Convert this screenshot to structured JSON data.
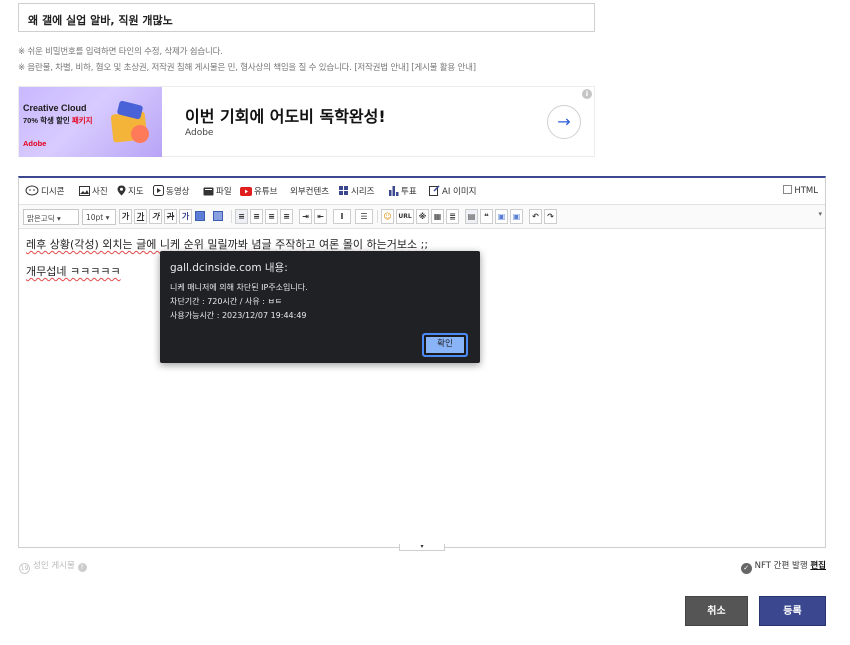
{
  "title_field": {
    "value": "왜 갤에 실업 알바, 직원 개많노"
  },
  "notices": [
    "※ 쉬운 비밀번호를 입력하면 타인의 수정, 삭제가 쉽습니다.",
    "※ 음란물, 차별, 비하, 혐오 및 초상권, 저작권 침해 게시물은 민, 형사상의 책임을 질 수 있습니다."
  ],
  "notice_links": [
    "[저작권법 안내]",
    "[게시물 활용 안내]"
  ],
  "ad": {
    "image_line1": "Creative Cloud",
    "image_line2_prefix": "70% 학생 할인",
    "image_line2_bold": "패키지",
    "image_brand": "Adobe",
    "headline": "이번 기회에 어도비 독학완성!",
    "sponsor": "Adobe",
    "arrow": "→",
    "info": "i"
  },
  "toolbar1": {
    "items": [
      "디시콘",
      "사진",
      "지도",
      "동영상",
      "파일",
      "유튜브",
      "외부컨텐츠",
      "시리즈",
      "투표",
      "AI 이미지"
    ],
    "html_label": "HTML"
  },
  "toolbar2": {
    "font": "맑은고딕",
    "size": "10pt",
    "bold": "가",
    "underline": "가",
    "italic": "가",
    "strike": "가",
    "color": "가",
    "url": "URL",
    "undo": "↶",
    "redo": "↷"
  },
  "content": {
    "line1": "레후 상황(각성) 외치는 글에 니케 순위 밀릴까봐 념글 주작하고 여론 몰이 하는거보소 ;;",
    "line2": "개무섭네 ㅋㅋㅋㅋㅋ"
  },
  "dialog": {
    "title": "gall.dcinside.com 내용:",
    "line1": "니케 매니저에 의해 차단된 IP주소입니다.",
    "line2": "차단기간 : 720시간 / 사유 : ㅂㅌ",
    "line3": "사용가능시간 : 2023/12/07 19:44:49",
    "ok": "확인"
  },
  "adult": {
    "label": "성인 게시물"
  },
  "nft": {
    "label": "NFT 간편 발행",
    "edit": "편집"
  },
  "buttons": {
    "cancel": "취소",
    "submit": "등록"
  },
  "colors": {
    "accent": "#3b4890",
    "dialog_bg": "#202124",
    "ok": "#8ab4f8"
  }
}
